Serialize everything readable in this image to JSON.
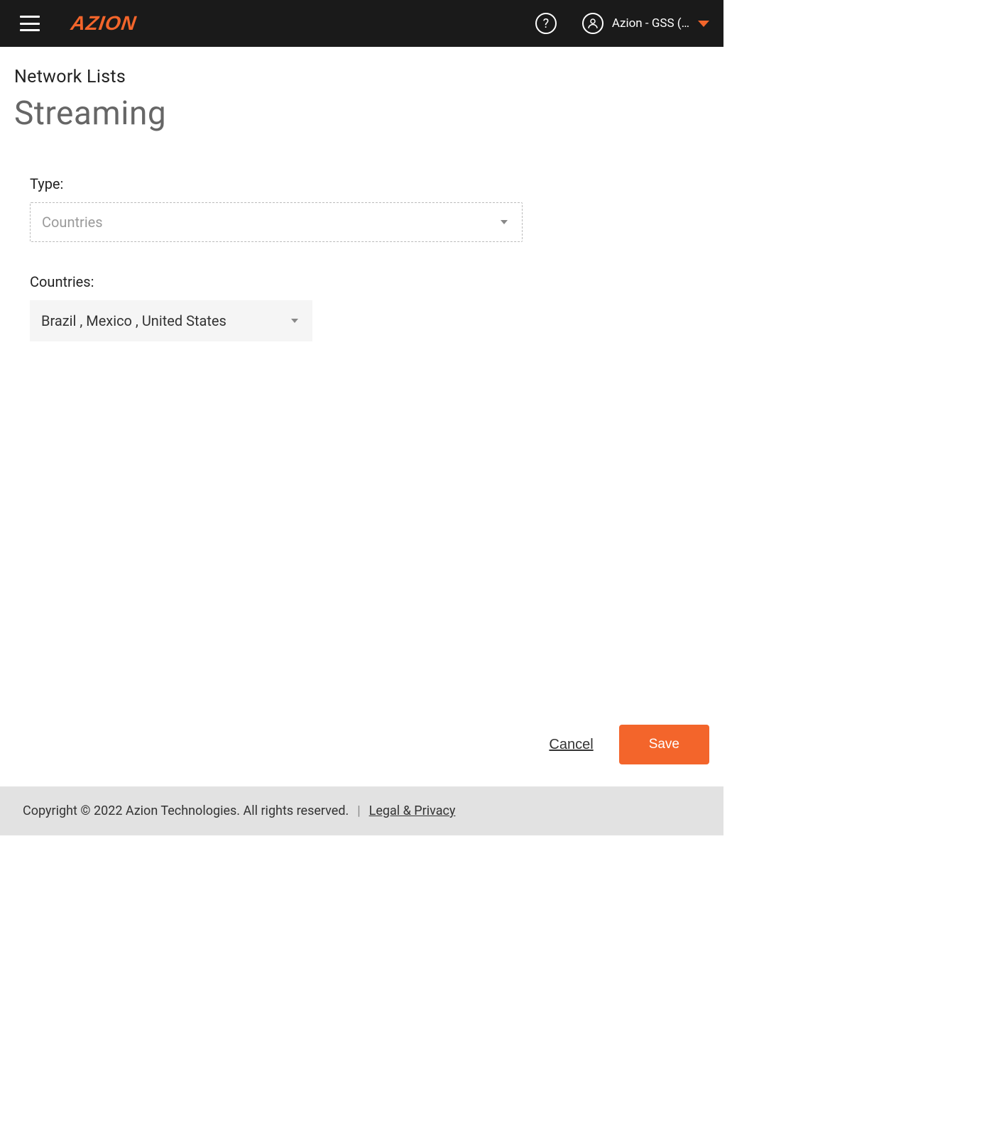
{
  "header": {
    "logo": "AZION",
    "user_label": "Azion - GSS (…"
  },
  "page": {
    "breadcrumb": "Network Lists",
    "title": "Streaming"
  },
  "form": {
    "type_label": "Type:",
    "type_value": "Countries",
    "countries_label": "Countries:",
    "countries_value": "Brazil , Mexico , United States"
  },
  "actions": {
    "cancel": "Cancel",
    "save": "Save"
  },
  "footer": {
    "copyright": "Copyright © 2022 Azion Technologies. All rights reserved.",
    "legal_link": "Legal & Privacy"
  }
}
